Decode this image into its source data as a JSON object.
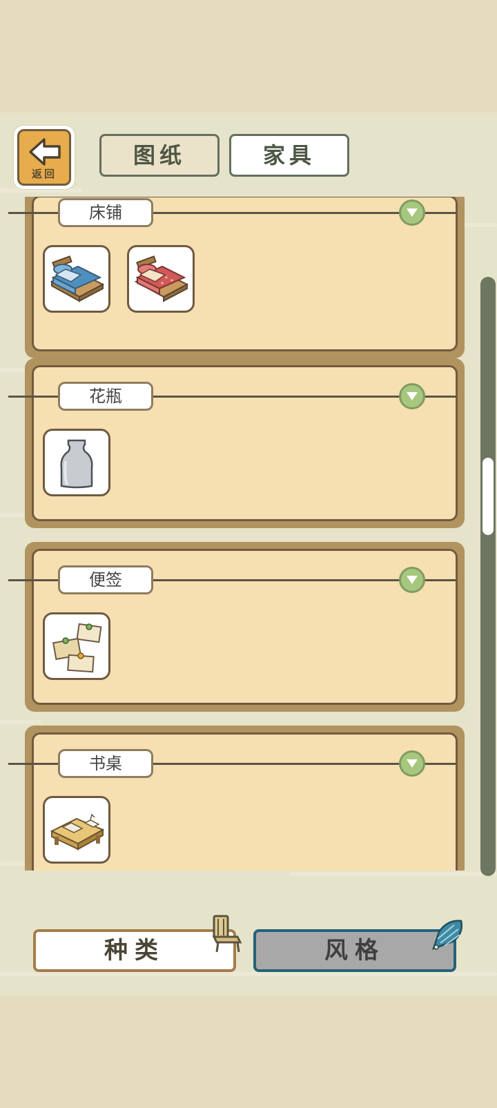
{
  "header": {
    "back_label": "返回",
    "tabs": [
      {
        "label": "图纸",
        "selected": false
      },
      {
        "label": "家具",
        "selected": true
      }
    ]
  },
  "sections": [
    {
      "label": "床铺",
      "items": [
        {
          "icon": "blue-bed-icon"
        },
        {
          "icon": "red-bed-icon"
        }
      ]
    },
    {
      "label": "花瓶",
      "items": [
        {
          "icon": "vase-icon"
        }
      ]
    },
    {
      "label": "便签",
      "items": [
        {
          "icon": "sticky-notes-icon"
        }
      ]
    },
    {
      "label": "书桌",
      "items": [
        {
          "icon": "desk-icon"
        }
      ]
    }
  ],
  "footer": {
    "category_label": "种类",
    "style_label": "风格"
  },
  "colors": {
    "panel_fill": "#f6dfb0",
    "panel_border": "#b0935f",
    "accent_green": "#a6c77d",
    "style_border": "#23627a"
  }
}
